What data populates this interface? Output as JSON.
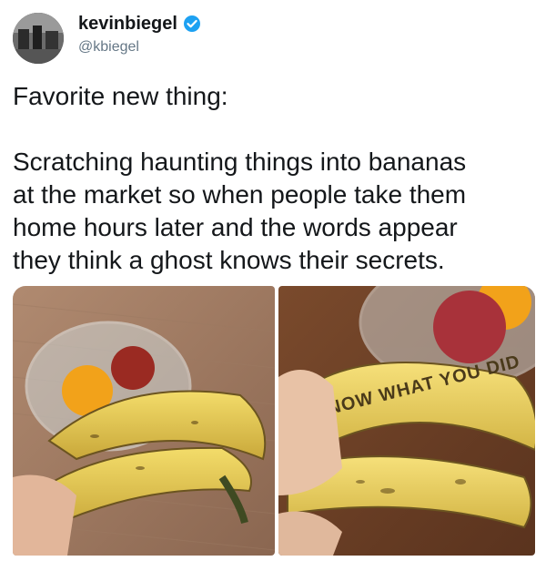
{
  "author": {
    "display_name": "kevinbiegel",
    "handle": "@kbiegel",
    "verified_icon": "verified-badge-icon",
    "verified_color": "#1da1f2"
  },
  "tweet": {
    "line1": "Favorite new thing:",
    "line2": "Scratching haunting things into bananas\nat the market so when people take them\nhome hours later and the words appear\nthey think a ghost knows their secrets."
  },
  "photos": {
    "right_scratched_text": "I KNOW WHAT YOU DID"
  }
}
